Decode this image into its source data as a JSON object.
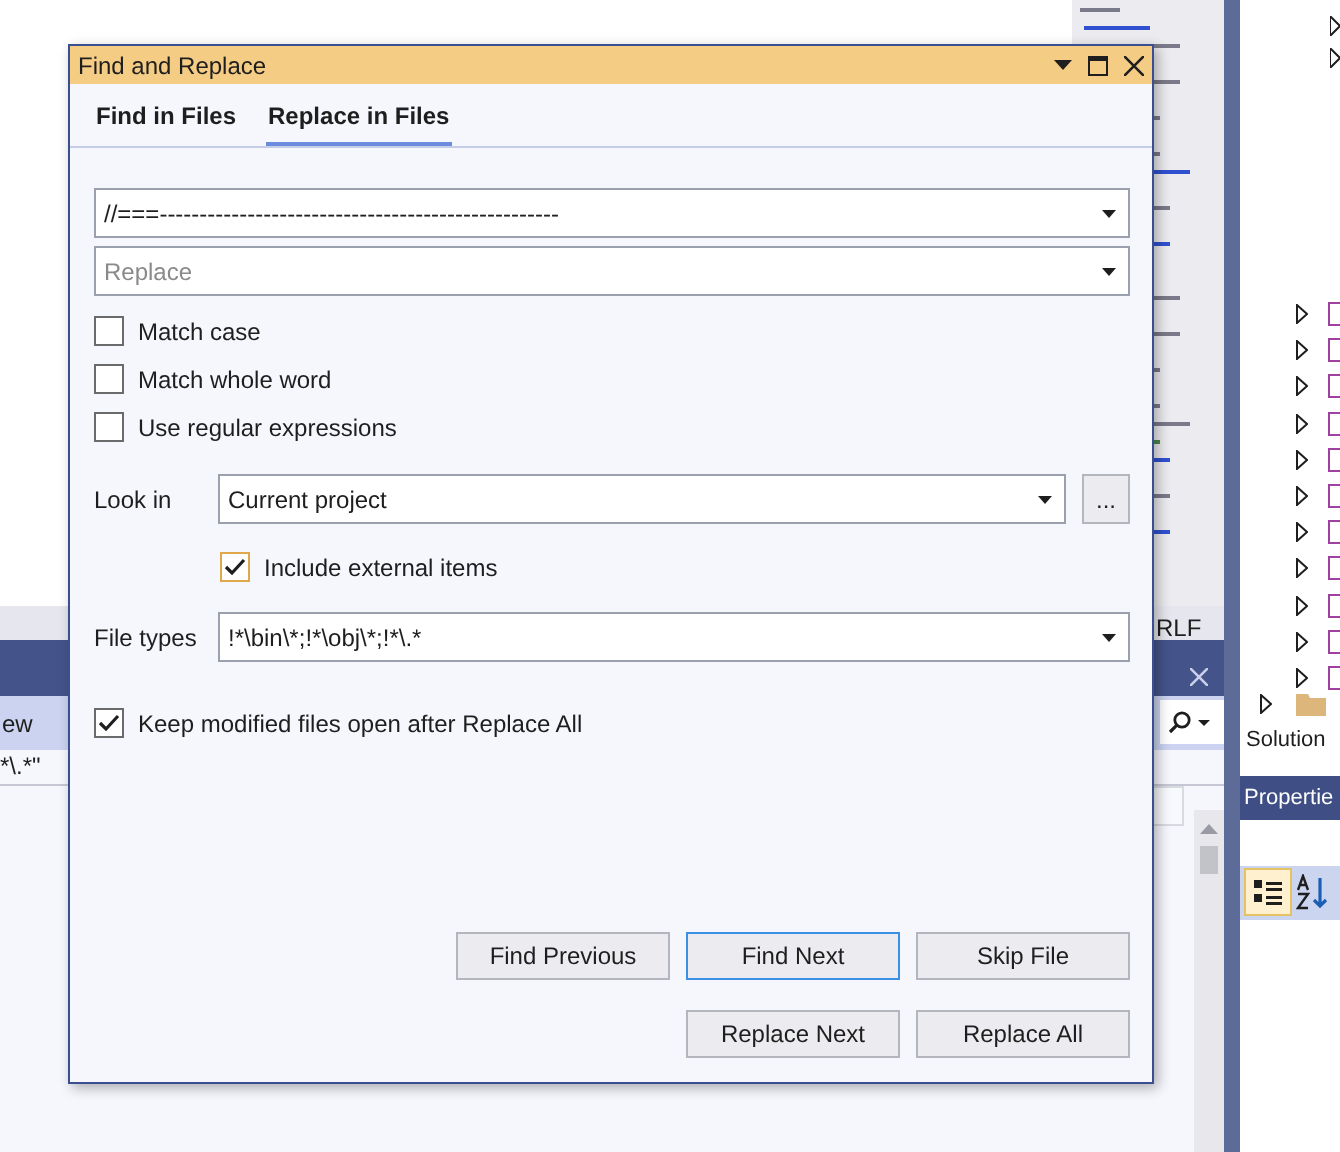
{
  "ide": {
    "status_text": "RLF",
    "results_rows": [
      "ew",
      "*\\.*\""
    ],
    "solution_label": "Solution",
    "properties_title": "Propertie"
  },
  "dialog": {
    "title": "Find and Replace",
    "tabs": [
      {
        "label": "Find in Files",
        "selected": false
      },
      {
        "label": "Replace in Files",
        "selected": true
      }
    ],
    "find": {
      "value": "//===--------------------------------------------------"
    },
    "replace": {
      "placeholder": "Replace"
    },
    "options": [
      {
        "label": "Match case",
        "checked": false
      },
      {
        "label": "Match whole word",
        "checked": false
      },
      {
        "label": "Use regular expressions",
        "checked": false
      }
    ],
    "look_in": {
      "label": "Look in",
      "value": "Current project",
      "browse": "..."
    },
    "include_external": {
      "label": "Include external items",
      "checked": true
    },
    "file_types": {
      "label": "File types",
      "value": "!*\\bin\\*;!*\\obj\\*;!*\\.*"
    },
    "keep_open": {
      "label": "Keep modified files open after Replace All",
      "checked": true
    },
    "button_rows": [
      [
        {
          "label": "Find Previous",
          "focused": false
        },
        {
          "label": "Find Next",
          "focused": true
        },
        {
          "label": "Skip File",
          "focused": false
        }
      ],
      [
        {
          "label": "Replace Next",
          "focused": false
        },
        {
          "label": "Replace All",
          "focused": false
        }
      ]
    ]
  }
}
